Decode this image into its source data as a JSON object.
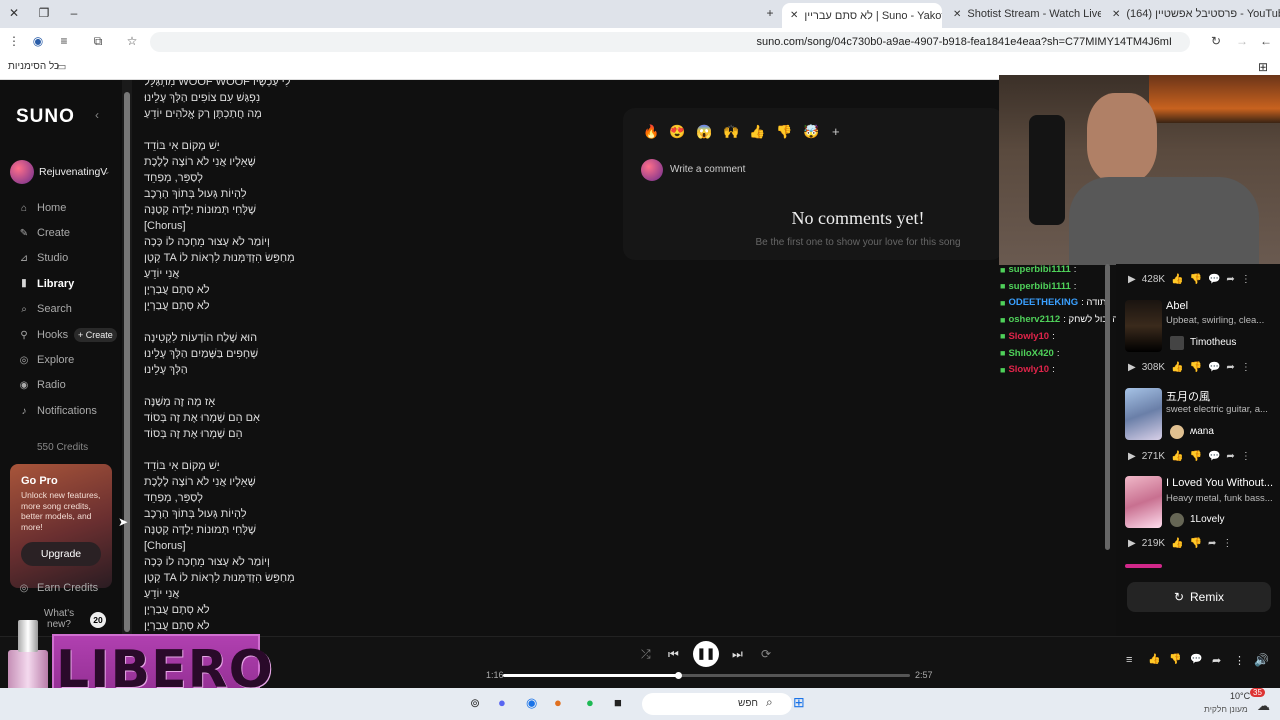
{
  "browser": {
    "tabs": [
      {
        "label": "(164) פרסטיבל אפשטיין - YouTube"
      },
      {
        "label": "Shotist Stream - Watch Live on"
      },
      {
        "label": "לא סתם עבריין | Suno - Yakot"
      }
    ],
    "url": "suno.com/song/04c730b0-a9ae-4907-b918-fea1841e4eaa?sh=C77MIMY14TM4J6mI",
    "bookmarks_label": "כל הסימניות"
  },
  "sidebar": {
    "logo": "SUNO",
    "user": "RejuvenatingV",
    "items": [
      {
        "label": "Home",
        "icon": "home-icon"
      },
      {
        "label": "Create",
        "icon": "create-icon"
      },
      {
        "label": "Studio",
        "icon": "studio-icon"
      },
      {
        "label": "Library",
        "icon": "library-icon"
      },
      {
        "label": "Search",
        "icon": "search-icon"
      },
      {
        "label": "Hooks",
        "icon": "hooks-icon"
      },
      {
        "label": "Explore",
        "icon": "explore-icon"
      },
      {
        "label": "Radio",
        "icon": "radio-icon"
      },
      {
        "label": "Notifications",
        "icon": "bell-icon"
      }
    ],
    "hooks_create": "+ Create",
    "credits": "550 Credits",
    "gopro": {
      "title": "Go Pro",
      "text": "Unlock new features, more song credits, better models, and more!",
      "button": "Upgrade"
    },
    "earn_credits": "Earn Credits",
    "whats_new": "What's new?",
    "whats_new_count": "20"
  },
  "lyrics": [
    "מִתְגַּלֵּל WOOF WOOF לִי עַכְשָׁיו",
    "נִפְגַּשׁ עִם צוֹפִים הַלְּךְ עָלֵינוּ",
    "מָה חֲתַכְתֶּן רַק אֱלֹהִים יוֹדֵעַ",
    "",
    "יֵשׁ מָקוֹם אִי בּוֹדֵד",
    "שֶׁאֵלָיו אֲנִי לֹא רוֹצֶה לָלֶכֶת",
    "לְסַפֵּר, מְפַחֵד",
    "לִהְיוֹת גָּעוּל בְּתוֹךְ הָרֶכֶב",
    "שֶׁלְּחִי תְּמוּנוֹת יַלְדָּה קְטַנָּה",
    "[Chorus]",
    "וְיוֹמַר לֹא עָצוּר מֵחָכָה לוֹ כָּכָה",
    "קָטָן TA מְחַפֵּשׂ הִזְדַּמְּנוּת לִרְאוֹת לוֹ",
    "אֲנִי יוֹדֵעַ",
    "לֹא סְתָם עֲבַרְיָן",
    "לֹא סְתָם עֲבַרְיָן",
    "",
    "הוּא שָׁלַח הוֹדָעוֹת לִקְטִינָה",
    "שְׁחָפִים בַּשָּׁמַיִם הַלְּךְ עָלֵינוּ",
    "הַלְּךְ עָלֵינוּ",
    "",
    "אָז מָה זֶה מְשַׁנֶּה",
    "אִם הֵם שָׁמְרוּ אֶת זֶה בְּסוֹד",
    "הֵם שָׁמְרוּ אֶת זֶה בְּסוֹד",
    "",
    "יֵשׁ מָקוֹם אִי בּוֹדֵד",
    "שֶׁאֵלָיו אֲנִי לֹא רוֹצֶה לָלֶכֶת",
    "לְסַפֵּר, מְפַחֵד",
    "לִהְיוֹת גָּעוּל בְּתוֹךְ הָרֶכֶב",
    "שֶׁלְּחִי תְּמוּנוֹת יַלְדָּה קְטַנָּה",
    "[Chorus]",
    "וְיוֹמַר לֹא עָצוּר מֵחָכָה לוֹ כָּכָה",
    "קָטָן TA מְחַפֵּשׂ הִזְדַּמְּנוּת לִרְאוֹת לוֹ",
    "אֲנִי יוֹדֵעַ",
    "לֹא סְתָם עֲבַרְיָן",
    "לֹא סְתָם עֲבַרְיָן"
  ],
  "comments": {
    "placeholder": "Write a comment",
    "empty_title": "No comments yet!",
    "empty_sub": "Be the first one to show your love for this song",
    "reactions": [
      "🔥",
      "😍",
      "😱",
      "🙌",
      "👍",
      "👎",
      "🤯",
      "+"
    ]
  },
  "chat": [
    {
      "user": "superbibi1111",
      "msg": ":",
      "color": "#4fd15a"
    },
    {
      "user": "superbibi1111",
      "msg": ":",
      "color": "#4fd15a"
    },
    {
      "user": "ODEETHEKING",
      "msg": ": תודה",
      "color": "#3aa0ff"
    },
    {
      "user": "osherv2112",
      "msg": ": נעשה אתה יכול לשחק god of war עוד",
      "color": "#4fd15a"
    },
    {
      "user": "Slowly10",
      "msg": ":",
      "color": "#e0244a"
    },
    {
      "user": "ShiloX420",
      "msg": ":",
      "color": "#4fd15a"
    },
    {
      "user": "Slowly10",
      "msg": ":",
      "color": "#e0244a"
    }
  ],
  "right_list": [
    {
      "plays": "428K"
    },
    {
      "title": "Abel",
      "desc": "Upbeat, swirling, clea...",
      "artist": "Timotheus",
      "plays": "308K"
    },
    {
      "title": "五月の風",
      "desc": "sweet electric guitar, a...",
      "artist": "ʍana",
      "plays": "271K"
    },
    {
      "title": "I Loved You Without...",
      "desc": "Heavy metal, funk bass...",
      "artist": "1Lovely",
      "plays": "219K"
    }
  ],
  "remix_label": "Remix",
  "player": {
    "current": "1:16",
    "total": "2:57",
    "progress": 0.43
  },
  "overlay": {
    "brand": "LIBERO"
  },
  "taskbar": {
    "search": "חפש",
    "weather": "10°C",
    "weather_sub": "מעונן חלקית",
    "notif": "35"
  },
  "colors": {
    "accent": "#e8e8e8",
    "chat_green": "#4fd15a"
  }
}
